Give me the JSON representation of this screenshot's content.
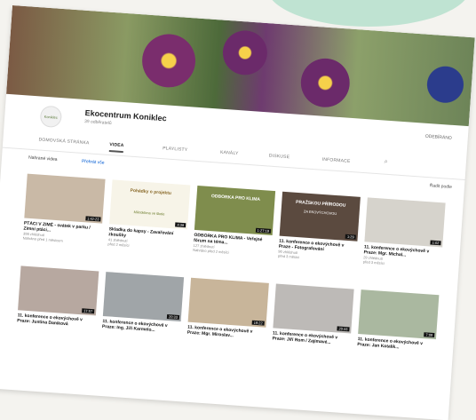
{
  "channel": {
    "name": "Ekocentrum Koniklec",
    "subscribers": "39 odběratelů",
    "subscribe_label": "ODEBÍRÁNO"
  },
  "avatar_text": "Koniklec",
  "tabs": [
    "DOMOVSKÁ STRÁNKA",
    "VIDEA",
    "PLAYLISTY",
    "KANÁLY",
    "DISKUSE",
    "INFORMACE"
  ],
  "active_tab": "VIDEA",
  "sort": {
    "left": "Nahrané videa",
    "right": "Přehrát vše",
    "sort_by": "Řadit podle"
  },
  "row1": [
    {
      "title": "PTÁCI V ZIMĚ - svátek v parku / Zimní ptáci...",
      "meta1": "398 zhlédnutí",
      "meta2": "Nahráno před 1 měsícem",
      "duration": "1:42:23",
      "thumb_text1": "",
      "thumb_text2": "",
      "color": "#c9b9a6"
    },
    {
      "title": "Skladka do kapsy - Zavařování zkoušky",
      "meta1": "41 zhlédnutí",
      "meta2": "před 2 měsíci",
      "duration": "4:38",
      "thumb_text1": "Pohádky o projektu",
      "thumb_text2": "Mikroklima ve škole",
      "color": "#f7f4e8"
    },
    {
      "title": "ODBORKA PRO KLIMA - Veřejné fórum na téma...",
      "meta1": "127 zhlédnutí",
      "meta2": "Nahráno před 2 měsíci",
      "duration": "1:27:19",
      "thumb_text1": "ODBORKA PRO KLIMA",
      "thumb_text2": "",
      "color": "#7f8d4d"
    },
    {
      "title": "11. konference o ekovýchově v Praze - Fotografování",
      "meta1": "90 zhlédnutí",
      "meta2": "před 3 měsíci",
      "duration": "1:29",
      "thumb_text1": "PRAŽSKOU PŘÍRODOU",
      "thumb_text2": "ZA EKOVÝCHOVOU",
      "color": "#5b4a3f"
    },
    {
      "title": "11. konference o ekovýchově v Praze: Mgr. Michal...",
      "meta1": "29 zhlédnutí",
      "meta2": "před 3 měsíci",
      "duration": "1:02",
      "thumb_text1": "",
      "thumb_text2": "",
      "color": "#d6d3cc"
    }
  ],
  "row2": [
    {
      "title": "11. konference o ekovýchově v Praze: Justina Daniková",
      "meta1": "",
      "meta2": "",
      "duration": "17:57",
      "color": "#b7a8a0"
    },
    {
      "title": "11. konference o ekovýchově v Praze: Ing. Jiří Karmelo...",
      "meta1": "",
      "meta2": "",
      "duration": "20:33",
      "color": "#a0a5a8"
    },
    {
      "title": "11. konference o ekovýchově v Praze: Mgr. Miroslav...",
      "meta1": "",
      "meta2": "",
      "duration": "19:22",
      "color": "#c8b59a"
    },
    {
      "title": "11. konference o ekovýchově v Praze: Jiří Rom / Zajímavé...",
      "meta1": "",
      "meta2": "",
      "duration": "20:33",
      "color": "#bdbab7"
    },
    {
      "title": "11. konference o ekovýchově v Praze: Jan Kotalík...",
      "meta1": "",
      "meta2": "",
      "duration": "7:09",
      "color": "#aab8a0"
    }
  ]
}
